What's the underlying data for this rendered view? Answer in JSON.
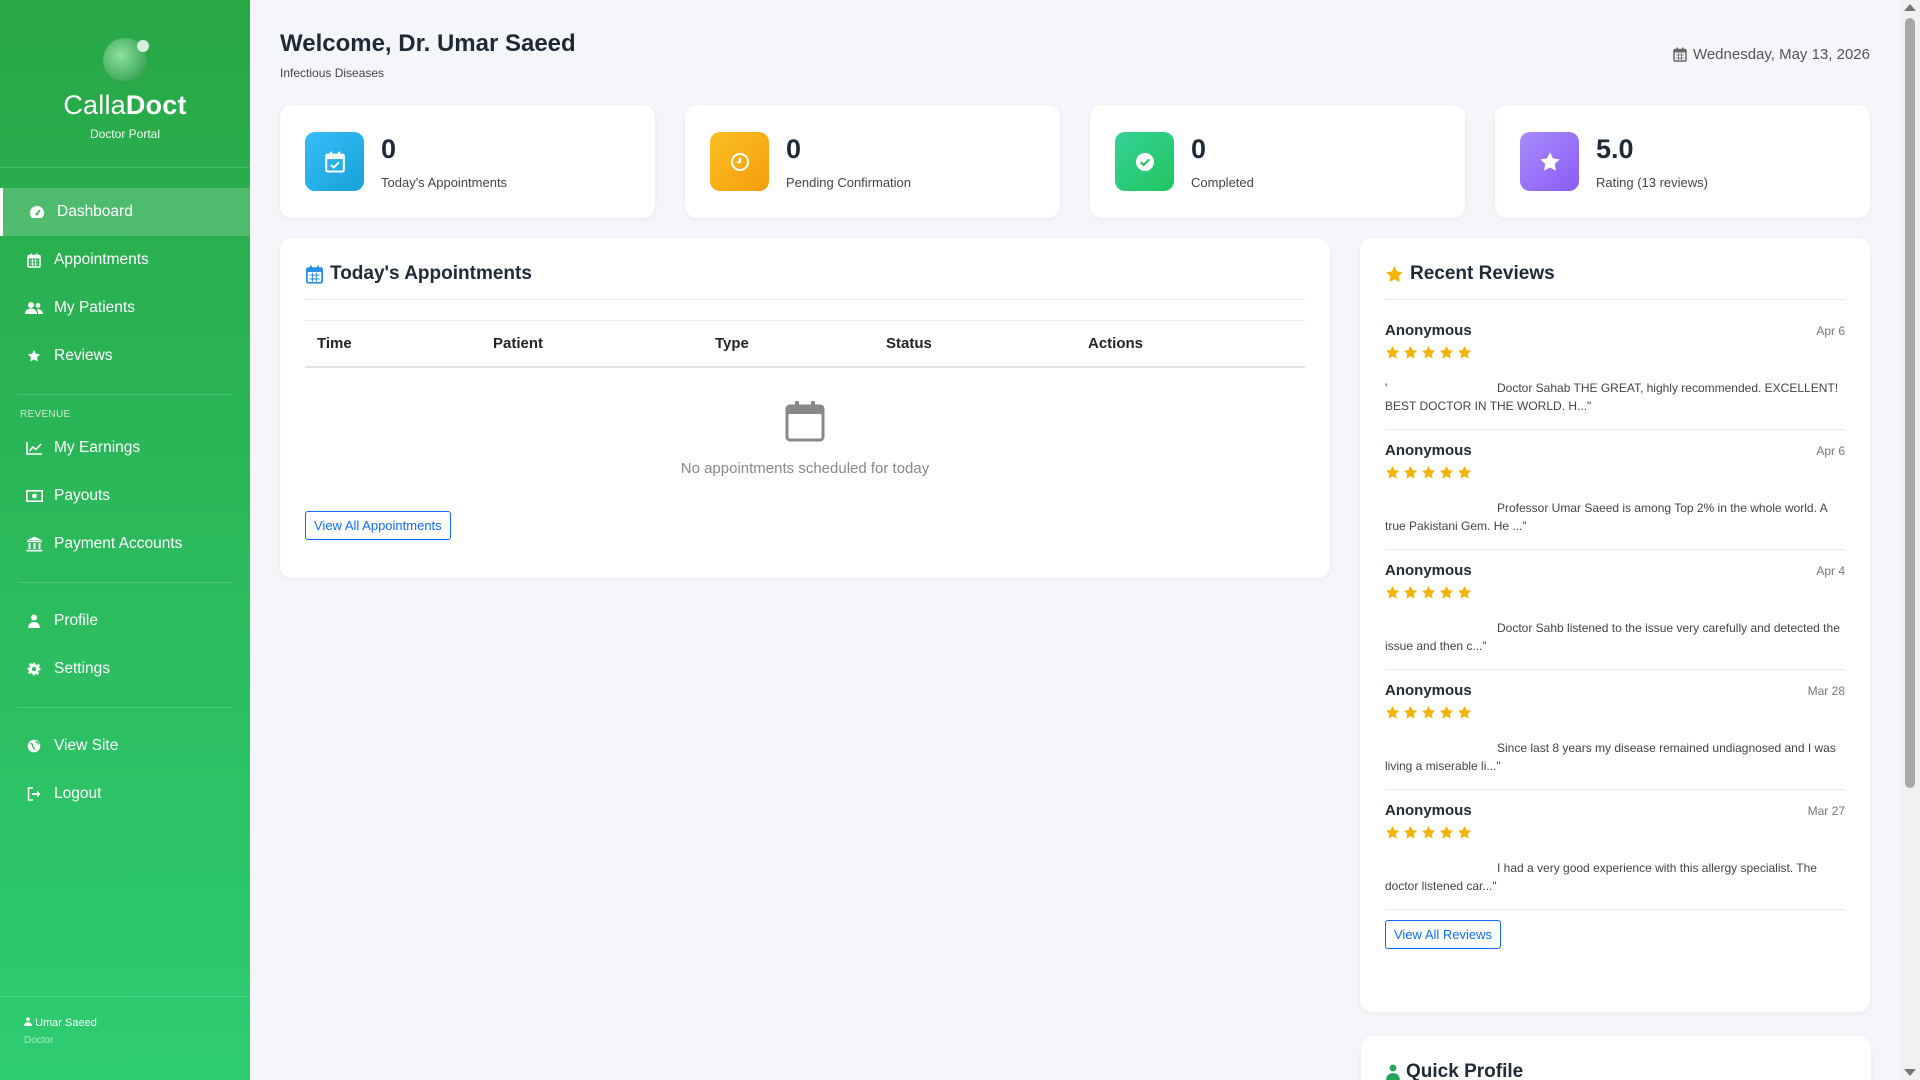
{
  "brand": {
    "name_light": "Calla",
    "name_bold": "Doct",
    "subtitle": "Doctor Portal"
  },
  "nav": {
    "main": [
      {
        "label": "Dashboard",
        "icon": "dashboard-icon",
        "active": true
      },
      {
        "label": "Appointments",
        "icon": "calendar-icon"
      },
      {
        "label": "My Patients",
        "icon": "users-icon"
      },
      {
        "label": "Reviews",
        "icon": "star-icon"
      }
    ],
    "revenue_label": "REVENUE",
    "revenue": [
      {
        "label": "My Earnings",
        "icon": "chart-line-icon"
      },
      {
        "label": "Payouts",
        "icon": "money-icon"
      },
      {
        "label": "Payment Accounts",
        "icon": "bank-icon"
      }
    ],
    "account": [
      {
        "label": "Profile",
        "icon": "user-icon"
      },
      {
        "label": "Settings",
        "icon": "gear-icon"
      }
    ],
    "other": [
      {
        "label": "View Site",
        "icon": "globe-icon"
      },
      {
        "label": "Logout",
        "icon": "logout-icon"
      }
    ]
  },
  "footer": {
    "user": "Umar Saeed",
    "role": "Doctor"
  },
  "header": {
    "title": "Welcome, Dr. Umar Saeed",
    "subtitle": "Infectious Diseases",
    "date": "Wednesday, May 13, 2026"
  },
  "stats": [
    {
      "value": "0",
      "label": "Today's Appointments",
      "color": "#17a2d8"
    },
    {
      "value": "0",
      "label": "Pending Confirmation",
      "color": "#f59e0b"
    },
    {
      "value": "0",
      "label": "Completed",
      "color": "#22c55e"
    },
    {
      "value": "5.0",
      "label": "Rating (13 reviews)",
      "color": "#8b5cf6"
    }
  ],
  "appointments": {
    "title": "Today's Appointments",
    "columns": [
      "Time",
      "Patient",
      "Type",
      "Status",
      "Actions"
    ],
    "empty_message": "No appointments scheduled for today",
    "view_all_label": "View All Appointments"
  },
  "reviews": {
    "title": "Recent Reviews",
    "items": [
      {
        "name": "Anonymous",
        "date": "Apr 6",
        "rating": 5,
        "lead": "'",
        "text": "Doctor Sahab THE GREAT, highly recommended. EXCELLENT! BEST DOCTOR IN THE WORLD. H...\""
      },
      {
        "name": "Anonymous",
        "date": "Apr 6",
        "rating": 5,
        "lead": "",
        "text": "Professor Umar Saeed is among Top 2% in the whole world. A true Pakistani Gem. He ...\""
      },
      {
        "name": "Anonymous",
        "date": "Apr 4",
        "rating": 5,
        "lead": "",
        "text": "Doctor Sahb listened to the issue very carefully and detected the issue and then c...\""
      },
      {
        "name": "Anonymous",
        "date": "Mar 28",
        "rating": 5,
        "lead": "",
        "text": "Since last 8 years my disease remained undiagnosed and I was living a miserable li...\""
      },
      {
        "name": "Anonymous",
        "date": "Mar 27",
        "rating": 5,
        "lead": "",
        "text": "I had a very good experience with this allergy specialist. The doctor listened car...\""
      }
    ],
    "view_all_label": "View All Reviews",
    "star_color": "#f5b301"
  },
  "quick_profile": {
    "title": "Quick Profile"
  }
}
